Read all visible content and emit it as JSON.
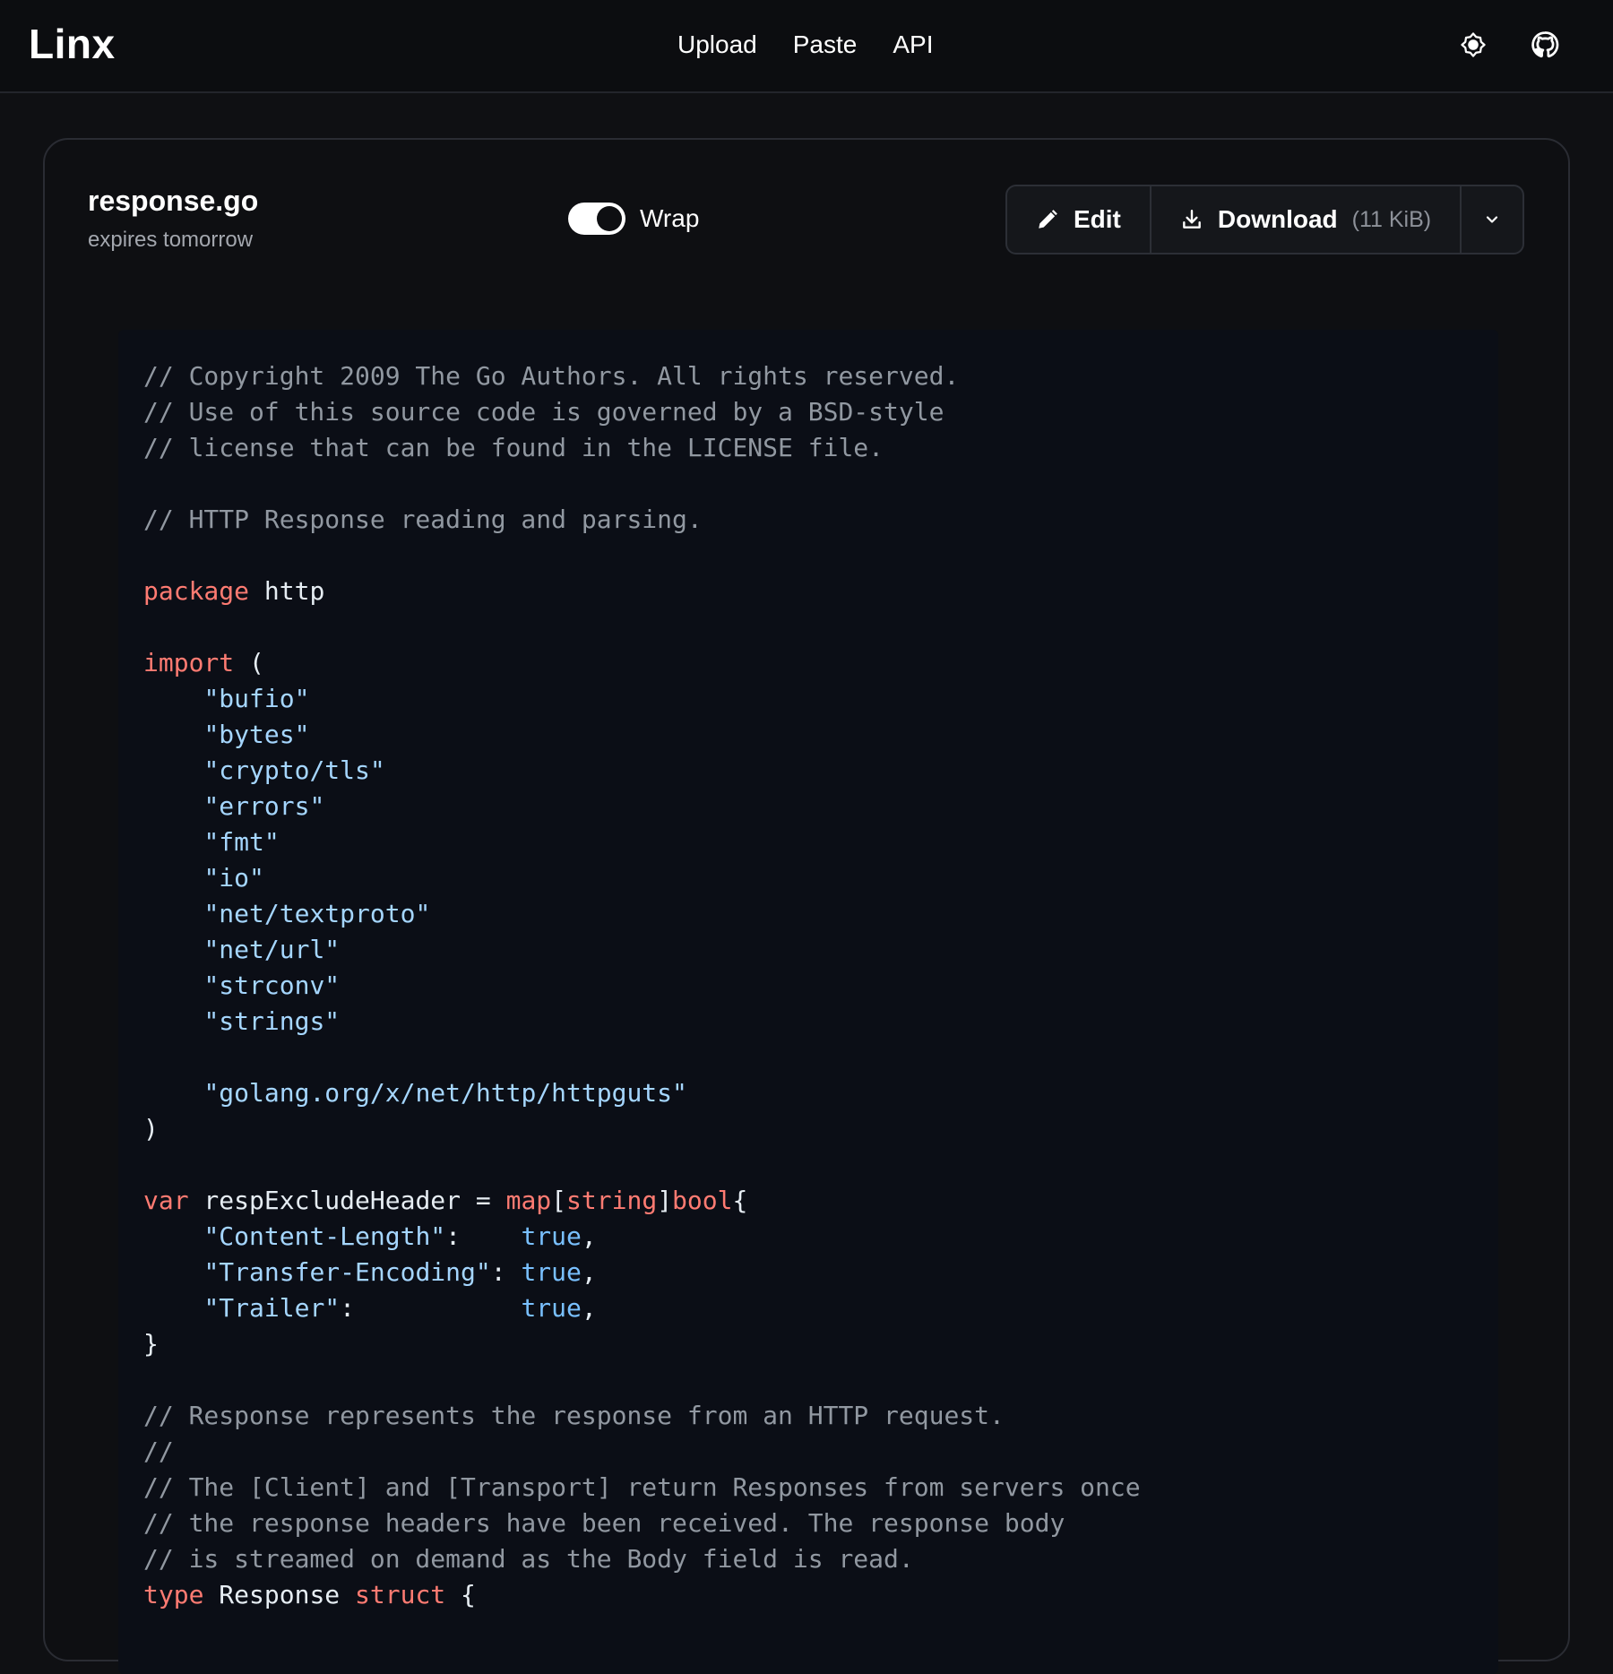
{
  "app": {
    "logo": "Linx",
    "nav": [
      {
        "label": "Upload"
      },
      {
        "label": "Paste"
      },
      {
        "label": "API"
      }
    ],
    "icons": [
      "theme-toggle-icon",
      "github-icon"
    ]
  },
  "file": {
    "name": "response.go",
    "expires": "expires tomorrow",
    "wrap_label": "Wrap",
    "wrap_enabled": true,
    "edit_label": "Edit",
    "download_label": "Download",
    "download_size": "(11 KiB)"
  },
  "colors": {
    "background": "#0f1013",
    "code_background": "#0b0e16",
    "comment": "#9198a1",
    "keyword": "#ff7b72",
    "string": "#a5d6ff",
    "literal": "#79c0ff"
  },
  "code_lines": [
    [
      {
        "c": "cm",
        "t": "// Copyright 2009 The Go Authors. All rights reserved."
      }
    ],
    [
      {
        "c": "cm",
        "t": "// Use of this source code is governed by a BSD-style"
      }
    ],
    [
      {
        "c": "cm",
        "t": "// license that can be found in the LICENSE file."
      }
    ],
    [],
    [
      {
        "c": "cm",
        "t": "// HTTP Response reading and parsing."
      }
    ],
    [],
    [
      {
        "c": "kw",
        "t": "package"
      },
      {
        "c": "plain",
        "t": " http"
      }
    ],
    [],
    [
      {
        "c": "kw",
        "t": "import"
      },
      {
        "c": "plain",
        "t": " ("
      }
    ],
    [
      {
        "c": "plain",
        "t": "    "
      },
      {
        "c": "str",
        "t": "\"bufio\""
      }
    ],
    [
      {
        "c": "plain",
        "t": "    "
      },
      {
        "c": "str",
        "t": "\"bytes\""
      }
    ],
    [
      {
        "c": "plain",
        "t": "    "
      },
      {
        "c": "str",
        "t": "\"crypto/tls\""
      }
    ],
    [
      {
        "c": "plain",
        "t": "    "
      },
      {
        "c": "str",
        "t": "\"errors\""
      }
    ],
    [
      {
        "c": "plain",
        "t": "    "
      },
      {
        "c": "str",
        "t": "\"fmt\""
      }
    ],
    [
      {
        "c": "plain",
        "t": "    "
      },
      {
        "c": "str",
        "t": "\"io\""
      }
    ],
    [
      {
        "c": "plain",
        "t": "    "
      },
      {
        "c": "str",
        "t": "\"net/textproto\""
      }
    ],
    [
      {
        "c": "plain",
        "t": "    "
      },
      {
        "c": "str",
        "t": "\"net/url\""
      }
    ],
    [
      {
        "c": "plain",
        "t": "    "
      },
      {
        "c": "str",
        "t": "\"strconv\""
      }
    ],
    [
      {
        "c": "plain",
        "t": "    "
      },
      {
        "c": "str",
        "t": "\"strings\""
      }
    ],
    [],
    [
      {
        "c": "plain",
        "t": "    "
      },
      {
        "c": "str",
        "t": "\"golang.org/x/net/http/httpguts\""
      }
    ],
    [
      {
        "c": "plain",
        "t": ")"
      }
    ],
    [],
    [
      {
        "c": "kw",
        "t": "var"
      },
      {
        "c": "plain",
        "t": " respExcludeHeader = "
      },
      {
        "c": "kw",
        "t": "map"
      },
      {
        "c": "plain",
        "t": "["
      },
      {
        "c": "kw",
        "t": "string"
      },
      {
        "c": "plain",
        "t": "]"
      },
      {
        "c": "kw",
        "t": "bool"
      },
      {
        "c": "plain",
        "t": "{"
      }
    ],
    [
      {
        "c": "plain",
        "t": "    "
      },
      {
        "c": "str",
        "t": "\"Content-Length\""
      },
      {
        "c": "plain",
        "t": ":    "
      },
      {
        "c": "lit",
        "t": "true"
      },
      {
        "c": "plain",
        "t": ","
      }
    ],
    [
      {
        "c": "plain",
        "t": "    "
      },
      {
        "c": "str",
        "t": "\"Transfer-Encoding\""
      },
      {
        "c": "plain",
        "t": ": "
      },
      {
        "c": "lit",
        "t": "true"
      },
      {
        "c": "plain",
        "t": ","
      }
    ],
    [
      {
        "c": "plain",
        "t": "    "
      },
      {
        "c": "str",
        "t": "\"Trailer\""
      },
      {
        "c": "plain",
        "t": ":           "
      },
      {
        "c": "lit",
        "t": "true"
      },
      {
        "c": "plain",
        "t": ","
      }
    ],
    [
      {
        "c": "plain",
        "t": "}"
      }
    ],
    [],
    [
      {
        "c": "cm",
        "t": "// Response represents the response from an HTTP request."
      }
    ],
    [
      {
        "c": "cm",
        "t": "//"
      }
    ],
    [
      {
        "c": "cm",
        "t": "// The [Client] and [Transport] return Responses from servers once"
      }
    ],
    [
      {
        "c": "cm",
        "t": "// the response headers have been received. The response body"
      }
    ],
    [
      {
        "c": "cm",
        "t": "// is streamed on demand as the Body field is read."
      }
    ],
    [
      {
        "c": "kw",
        "t": "type"
      },
      {
        "c": "plain",
        "t": " Response "
      },
      {
        "c": "kw",
        "t": "struct"
      },
      {
        "c": "plain",
        "t": " {"
      }
    ]
  ]
}
